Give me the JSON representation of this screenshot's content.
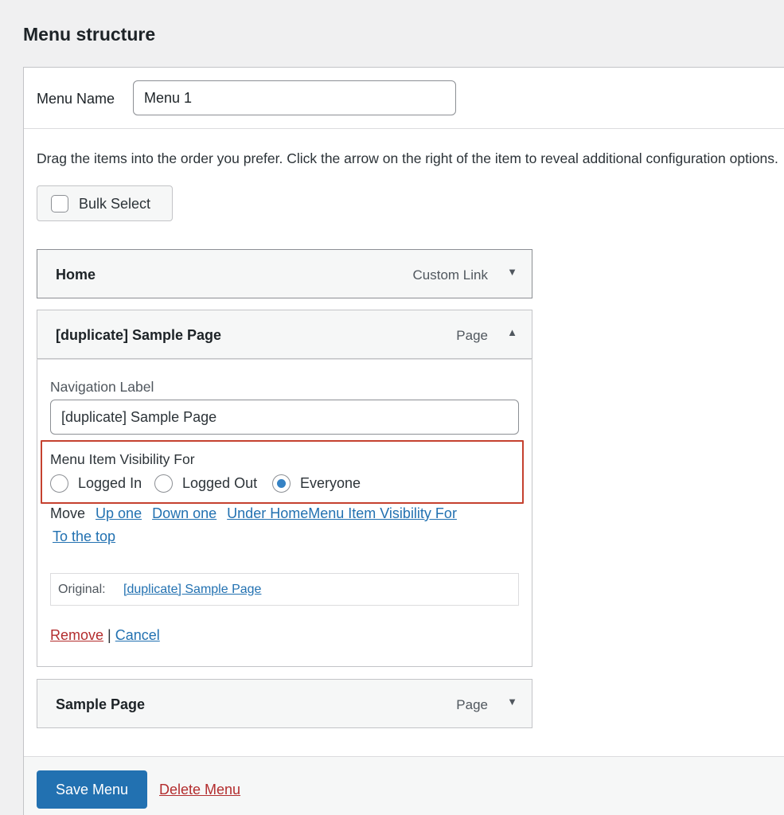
{
  "page": {
    "heading": "Menu structure"
  },
  "menu_name": {
    "label": "Menu Name",
    "value": "Menu 1"
  },
  "instructions": "Drag the items into the order you prefer. Click the arrow on the right of the item to reveal additional configuration options.",
  "bulk_select": {
    "label": "Bulk Select"
  },
  "items": [
    {
      "title": "Home",
      "type": "Custom Link",
      "arrow": "▼"
    },
    {
      "title": "[duplicate] Sample Page",
      "type": "Page",
      "arrow": "▲"
    },
    {
      "title": "Sample Page",
      "type": "Page",
      "arrow": "▼"
    }
  ],
  "settings": {
    "navigation_label_title": "Navigation Label",
    "navigation_label_value": "[duplicate] Sample Page",
    "visibility_title": "Menu Item Visibility For",
    "visibility_options": [
      "Logged In",
      "Logged Out",
      "Everyone"
    ],
    "visibility_selected": "Everyone",
    "move_label": "Move",
    "move_links": [
      "Up one",
      "Down one",
      "Under HomeMenu Item Visibility For",
      "To the top"
    ],
    "original_label": "Original:",
    "original_link": "[duplicate] Sample Page",
    "remove_label": "Remove",
    "separator": "|",
    "cancel_label": "Cancel"
  },
  "footer": {
    "save_label": "Save Menu",
    "delete_label": "Delete Menu"
  },
  "colors": {
    "primary": "#2271b1",
    "danger": "#b32d2e",
    "highlight": "#c5412f"
  }
}
